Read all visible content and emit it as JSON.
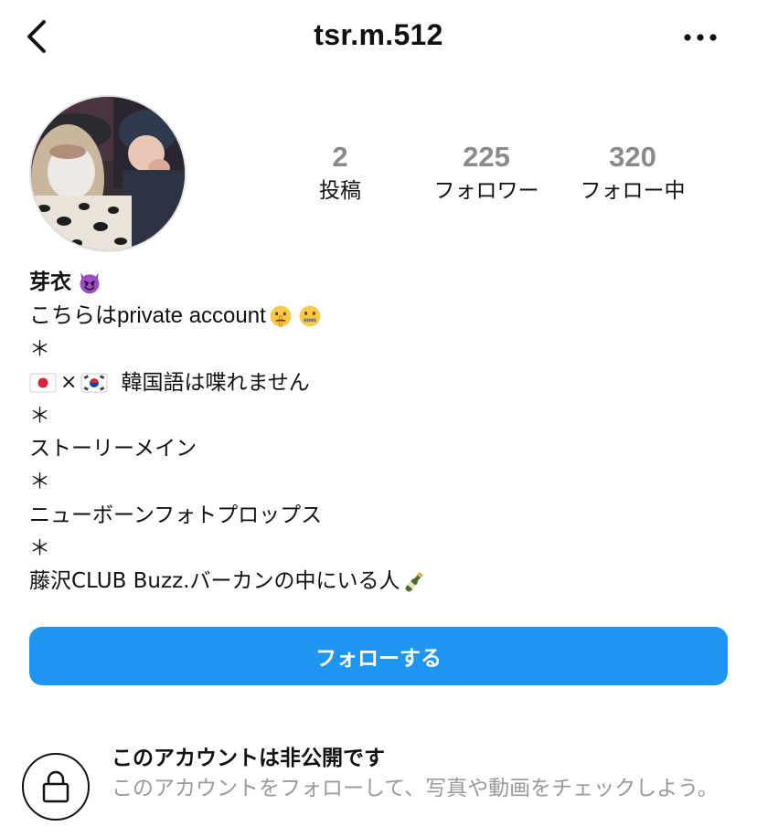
{
  "header": {
    "username": "tsr.m.512",
    "back_icon": "chevron-left-icon",
    "more_icon": "more-horizontal-icon"
  },
  "profile": {
    "avatar_alt": "profile photo",
    "stats": {
      "posts": {
        "count": "2",
        "label": "投稿"
      },
      "followers": {
        "count": "225",
        "label": "フォロワー"
      },
      "following": {
        "count": "320",
        "label": "フォロー中"
      }
    },
    "bio": {
      "name": "芽衣",
      "name_emoji": "smiling-devil-emoji",
      "lines": [
        "こちらはprivate account",
        "＊",
        "×",
        "韓国語は喋れません",
        "＊",
        "ストーリーメイン",
        "＊",
        "ニューボーンフォトプロップス",
        "＊",
        "藤沢CLUB Buzz.バーカンの中にいる人"
      ]
    }
  },
  "actions": {
    "follow_label": "フォローする"
  },
  "private_notice": {
    "title": "このアカウントは非公開です",
    "description": "このアカウントをフォローして、写真や動画をチェックしよう。",
    "icon": "lock-icon"
  },
  "colors": {
    "accent": "#1f95f2",
    "muted_text": "#9a9a9a",
    "stat_number": "#8a8a8a"
  }
}
